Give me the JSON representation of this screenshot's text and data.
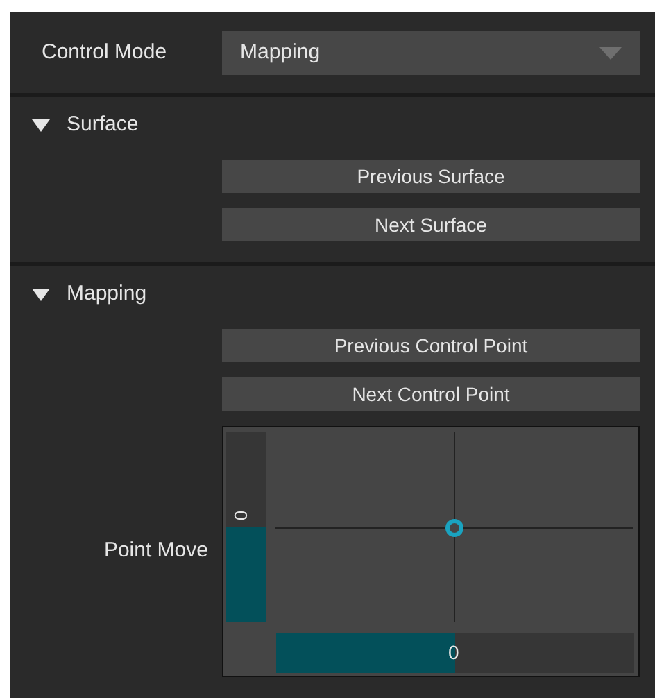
{
  "control_mode": {
    "label": "Control Mode",
    "value": "Mapping"
  },
  "sections": [
    {
      "title": "Surface",
      "expanded": true,
      "buttons": [
        "Previous Surface",
        "Next Surface"
      ]
    },
    {
      "title": "Mapping",
      "expanded": true,
      "buttons": [
        "Previous Control Point",
        "Next Control Point"
      ]
    }
  ],
  "point_move": {
    "label": "Point Move",
    "x_slider": {
      "level": 0.5,
      "reading": "0"
    },
    "y_slider": {
      "level": 0.5,
      "reading": "0"
    }
  }
}
